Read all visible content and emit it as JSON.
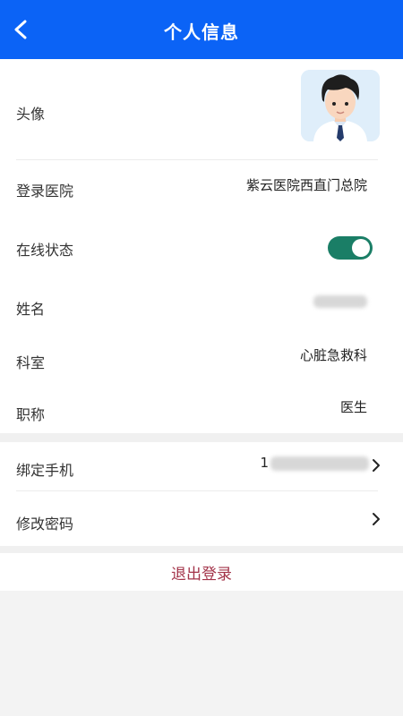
{
  "header": {
    "title": "个人信息"
  },
  "rows": {
    "avatar": {
      "label": "头像"
    },
    "hospital": {
      "label": "登录医院",
      "value": "紫云医院西直门总院"
    },
    "online": {
      "label": "在线状态",
      "state": "on"
    },
    "name": {
      "label": "姓名",
      "value": ""
    },
    "department": {
      "label": "科室",
      "value": "心脏急救科"
    },
    "title": {
      "label": "职称",
      "value": "医生"
    },
    "phone": {
      "label": "绑定手机",
      "value": "1"
    },
    "password": {
      "label": "修改密码"
    }
  },
  "actions": {
    "logout": "退出登录"
  },
  "colors": {
    "header": "#0b63f6",
    "toggle_on": "#1a7e66",
    "logout_text": "#a3344a"
  }
}
